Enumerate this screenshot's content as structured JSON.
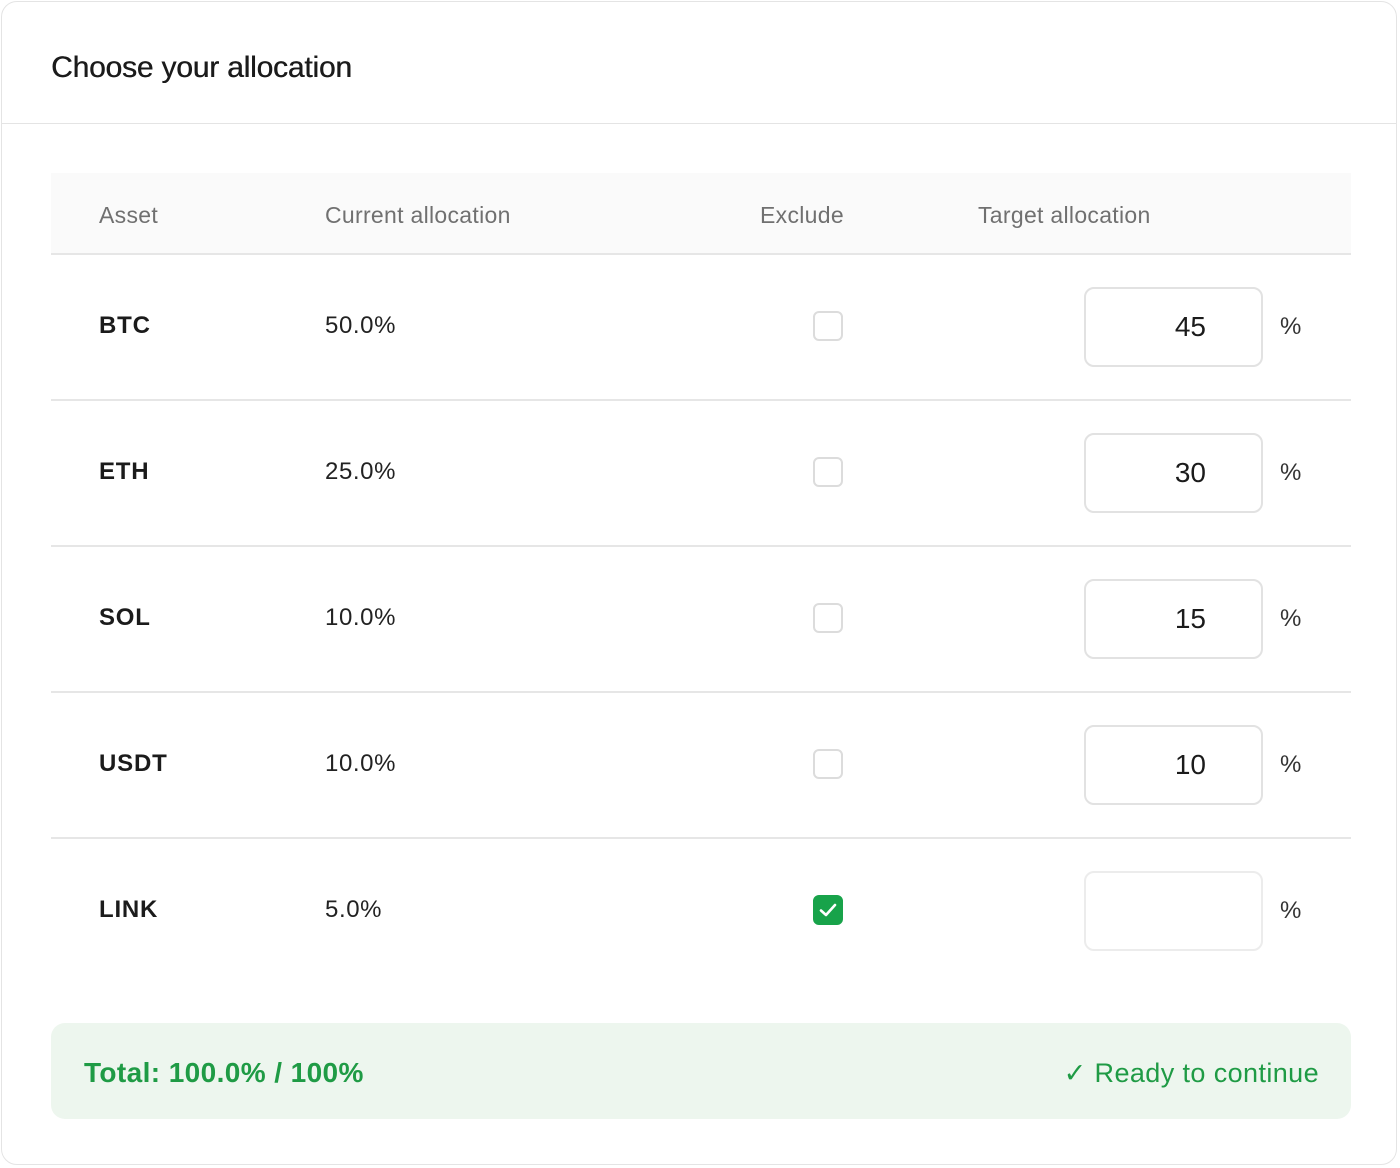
{
  "header": {
    "title": "Choose your allocation"
  },
  "table": {
    "columns": [
      "Asset",
      "Current allocation",
      "Exclude",
      "Target allocation"
    ],
    "rows": [
      {
        "asset": "BTC",
        "current": "50.0%",
        "excluded": false,
        "target": "45",
        "unit": "%"
      },
      {
        "asset": "ETH",
        "current": "25.0%",
        "excluded": false,
        "target": "30",
        "unit": "%"
      },
      {
        "asset": "SOL",
        "current": "10.0%",
        "excluded": false,
        "target": "15",
        "unit": "%"
      },
      {
        "asset": "USDT",
        "current": "10.0%",
        "excluded": false,
        "target": "10",
        "unit": "%"
      },
      {
        "asset": "LINK",
        "current": "5.0%",
        "excluded": true,
        "target": "",
        "unit": "%"
      }
    ]
  },
  "summary": {
    "total_label": "Total: 100.0% / 100%",
    "status_icon": "check-icon",
    "status_text": "✓ Ready to continue"
  },
  "colors": {
    "accent_green": "#18a34a",
    "summary_text": "#1f9b45",
    "summary_bg": "#edf6ee"
  }
}
